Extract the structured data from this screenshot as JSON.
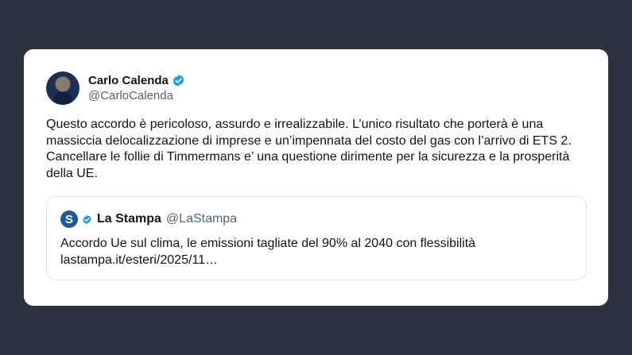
{
  "tweet": {
    "author": {
      "name": "Carlo Calenda",
      "handle": "@CarloCalenda",
      "avatar_icon": "person-avatar-icon",
      "verified": true
    },
    "text": "Questo accordo è pericoloso, assurdo e irrealizzabile. L’unico risultato che porterà è una massiccia delocalizzazione di imprese e un’impennata del costo del gas con l’arrivo di ETS 2. Cancellare le follie di Timmermans e’ una questione dirimente per la sicurezza e la prosperità della UE.",
    "quoted": {
      "name": "La Stampa",
      "handle": "@LaStampa",
      "logo_letter": "S",
      "verified": true,
      "text": "Accordo Ue sul clima, le emissioni tagliate del 90% al 2040 con flessibilità",
      "link": "lastampa.it/esteri/2025/11…"
    }
  },
  "colors": {
    "background": "#2c3340",
    "verified_badge": "#1d9bf0",
    "text_primary": "#0f1419",
    "text_secondary": "#536471"
  }
}
